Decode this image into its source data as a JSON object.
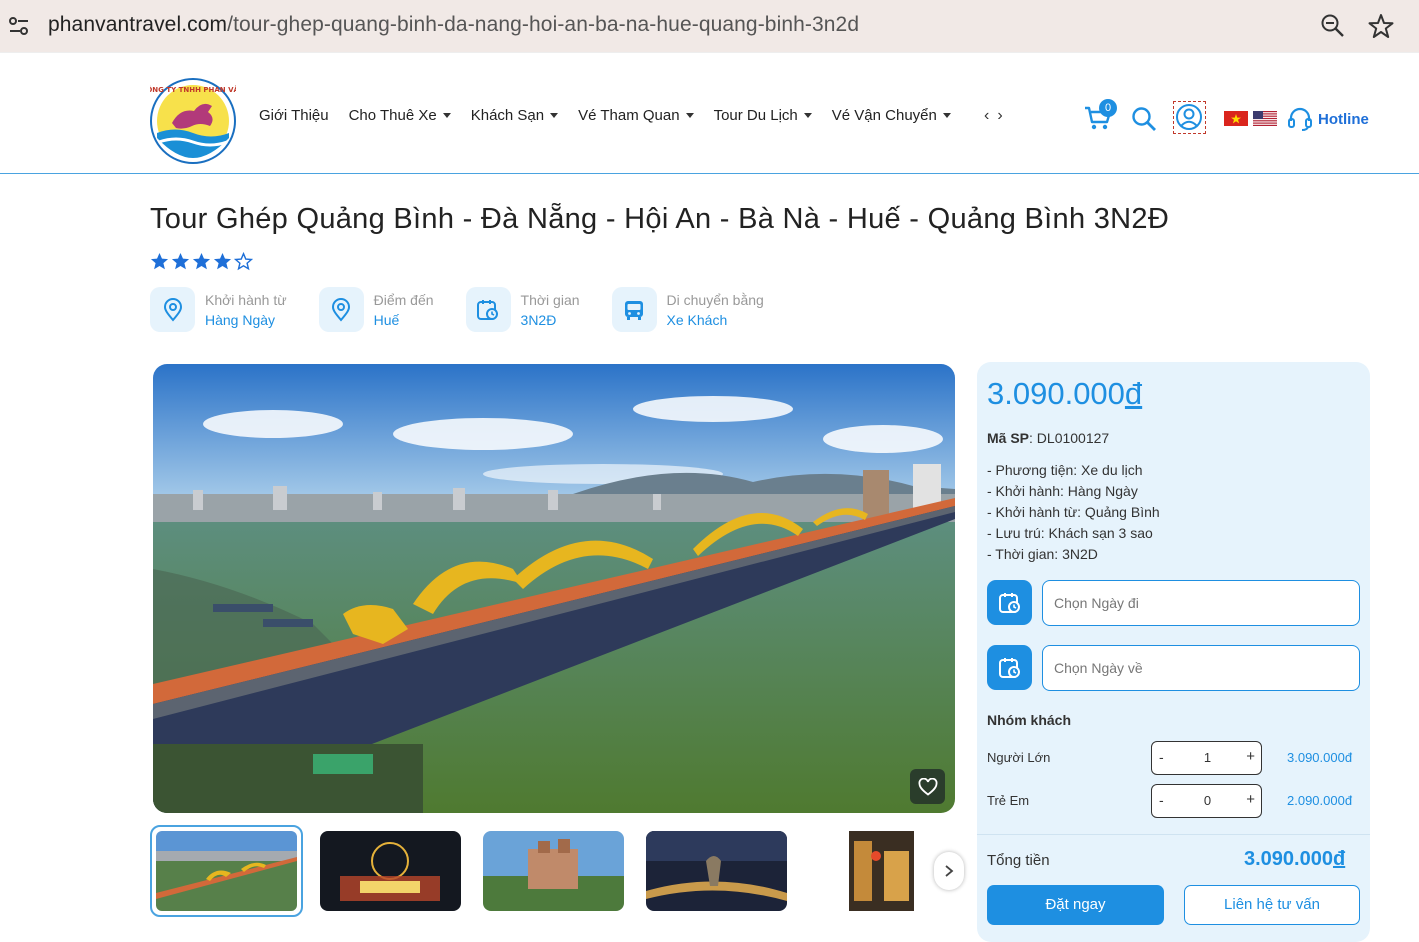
{
  "browser": {
    "url_domain": "phanvantravel.com",
    "url_path": "/tour-ghep-quang-binh-da-nang-hoi-an-ba-na-hue-quang-binh-3n2d",
    "icons": [
      "site-settings-icon",
      "zoom-icon",
      "bookmark-star-icon"
    ]
  },
  "header": {
    "logo_text": "CÔNG TY TNHH PHAN VĂN",
    "nav": [
      {
        "label": "Giới Thiệu",
        "has_dropdown": false
      },
      {
        "label": "Cho Thuê Xe",
        "has_dropdown": true
      },
      {
        "label": "Khách Sạn",
        "has_dropdown": true
      },
      {
        "label": "Vé Tham Quan",
        "has_dropdown": true
      },
      {
        "label": "Tour Du Lịch",
        "has_dropdown": true
      },
      {
        "label": "Vé Vận Chuyển",
        "has_dropdown": true
      }
    ],
    "nav_prev": "‹",
    "nav_next": "›",
    "cart_count": "0",
    "hotline_label": "Hotline"
  },
  "tour": {
    "title": "Tour Ghép Quảng Bình - Đà Nẵng - Hội An - Bà Nà - Huế - Quảng Bình 3N2Đ",
    "rating": 4,
    "rating_max": 5,
    "info": [
      {
        "icon": "location-pin-icon",
        "label": "Khởi hành từ",
        "value": "Hàng Ngày"
      },
      {
        "icon": "location-pin-icon",
        "label": "Điểm đến",
        "value": "Huế"
      },
      {
        "icon": "calendar-clock-icon",
        "label": "Thời gian",
        "value": "3N2Đ"
      },
      {
        "icon": "bus-icon",
        "label": "Di chuyển bằng",
        "value": "Xe Khách"
      }
    ]
  },
  "gallery": {
    "main_image": "dragon-bridge-da-nang-photo",
    "thumbnails": [
      "dragon-bridge-thumb",
      "night-festival-thumb",
      "castle-hill-thumb",
      "golden-bridge-night-thumb",
      "hoi-an-street-thumb"
    ],
    "active_index": 0
  },
  "booking": {
    "price": "3.090.000",
    "currency": "đ",
    "sku_label": "Mã SP",
    "sku_value": ": DL0100127",
    "details": [
      "- Phương tiện: Xe du lịch",
      "- Khởi hành: Hàng Ngày",
      "- Khởi hành từ: Quảng Bình",
      "- Lưu trú: Khách sạn 3 sao",
      "- Thời gian: 3N2D"
    ],
    "depart_placeholder": "Chọn Ngày đi",
    "return_placeholder": "Chọn Ngày về",
    "group_label": "Nhóm khách",
    "passengers": [
      {
        "label": "Người Lớn",
        "qty": "1",
        "price": "3.090.000đ"
      },
      {
        "label": "Trẻ Em",
        "qty": "0",
        "price": "2.090.000đ"
      }
    ],
    "stepper_minus": "-",
    "stepper_plus": "+",
    "total_label": "Tổng tiền",
    "total_value": "3.090.000",
    "total_currency": "đ",
    "book_label": "Đặt ngay",
    "contact_label": "Liên hệ tư vấn"
  },
  "colors": {
    "accent": "#1e8fe1",
    "panel_bg": "#e6f3fc",
    "urlbar_bg": "#f1e9e6"
  }
}
